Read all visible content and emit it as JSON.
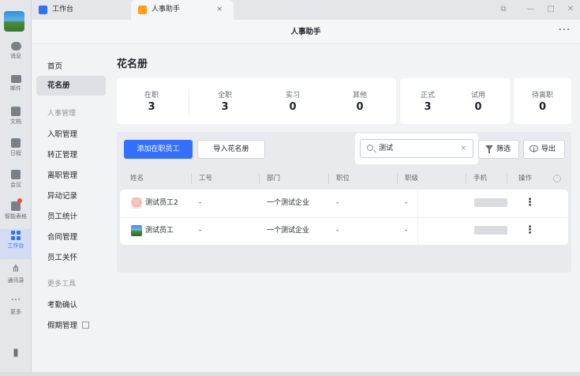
{
  "rail": {
    "items": [
      {
        "label": "消息",
        "icon": "chat-bubble-icon"
      },
      {
        "label": "邮件",
        "icon": "mail-icon"
      },
      {
        "label": "文档",
        "icon": "document-icon"
      },
      {
        "label": "日程",
        "icon": "calendar-icon"
      },
      {
        "label": "会议",
        "icon": "video-meeting-icon"
      },
      {
        "label": "智能表格",
        "icon": "smart-sheet-icon"
      },
      {
        "label": "工作台",
        "icon": "workbench-grid-icon"
      },
      {
        "label": "通讯录",
        "icon": "org-chart-icon"
      },
      {
        "label": "更多",
        "icon": "more-dots-icon"
      }
    ]
  },
  "titlebar": {
    "tabs": [
      {
        "label": "工作台"
      },
      {
        "label": "人事助手"
      }
    ],
    "close_glyph": "×",
    "win_controls": [
      "⧉",
      "—",
      "□",
      "✕"
    ]
  },
  "header": {
    "title": "人事助手",
    "more": "···"
  },
  "sidebar": {
    "items": [
      {
        "label": "首页"
      },
      {
        "label": "花名册"
      },
      {
        "label": "人事管理"
      },
      {
        "label": "入职管理"
      },
      {
        "label": "转正管理"
      },
      {
        "label": "离职管理"
      },
      {
        "label": "异动记录"
      },
      {
        "label": "员工统计"
      },
      {
        "label": "合同管理"
      },
      {
        "label": "员工关怀"
      },
      {
        "label": "更多工具"
      },
      {
        "label": "考勤确认"
      },
      {
        "label": "假期管理"
      }
    ]
  },
  "main": {
    "title": "花名册",
    "stats": [
      {
        "label": "在职",
        "value": "3"
      },
      {
        "label": "全职",
        "value": "3"
      },
      {
        "label": "实习",
        "value": "0"
      },
      {
        "label": "其他",
        "value": "0"
      },
      {
        "label": "正式",
        "value": "3"
      },
      {
        "label": "试用",
        "value": "0"
      },
      {
        "label": "待离职",
        "value": "0"
      }
    ],
    "toolbar": {
      "add_label": "添加在职员工",
      "import_label": "导入花名册",
      "search_value": "测试",
      "clear_glyph": "×",
      "filter_label": "筛选",
      "export_label": "导出"
    },
    "table": {
      "columns": [
        "姓名",
        "工号",
        "部门",
        "职位",
        "职级",
        "手机",
        "操作"
      ],
      "rows": [
        {
          "name": "测试员工2",
          "id": "-",
          "dept": "一个测试企业",
          "position": "-",
          "level": "-",
          "actions": "⋮"
        },
        {
          "name": "测试员工",
          "id": "-",
          "dept": "一个测试企业",
          "position": "-",
          "level": "-",
          "actions": "⋮"
        }
      ]
    }
  },
  "colors": {
    "accent": "#3370ff",
    "workbench_tab": "#ff9f1a",
    "badge": "#f54a45"
  }
}
